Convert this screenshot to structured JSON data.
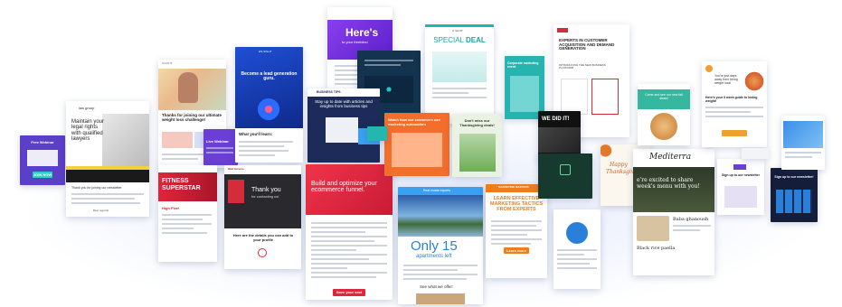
{
  "templates": {
    "t_webinar_small": {
      "headline": "Free Webinar",
      "button": "JOIN NOW"
    },
    "t_legal": {
      "brand": "law group",
      "headline": "Maintain your legal rights with qualified lawyers",
      "body": "Thank you for joining our newsletter",
      "signoff": "Best regards"
    },
    "t_weight": {
      "brand": "SLIMFIT",
      "headline": "Thanks for joining our ultimate weight loss challenge!"
    },
    "t_live": {
      "headline": "Live Webinar"
    },
    "t_fitness": {
      "headline1": "FITNESS",
      "headline2": "SUPERSTAR",
      "sub": "High Five!"
    },
    "t_leadgen": {
      "brand": "EN-SIGHT",
      "headline": "Become a lead generation guru.",
      "list_title": "What you'll learn:"
    },
    "t_contact": {
      "brand": "Well Service",
      "headline": "Thank you",
      "sub": "for contacting us!",
      "details": "Here are the details you can add to your profile"
    },
    "t_heres": {
      "headline": "Here's",
      "sub": "to your freebies!"
    },
    "t_business": {
      "brand": "BUSINESS TIPS",
      "headline": "Stay up to date with articles and insights from business tips"
    },
    "t_ecommerce": {
      "headline": "Build and optimize your ecommerce funnel.",
      "button": "Save your seat"
    },
    "t_special": {
      "brand": "O SHOP",
      "headline1": "SPECIAL",
      "headline2": "DEAL"
    },
    "t_calendar": {
      "headline": "Watch how our customers use marketing automation"
    },
    "t_thanksgiving_post": {
      "headline": "Don't miss our Thanksgiving deals!"
    },
    "t_apartments": {
      "brand": "Real estate experts",
      "big": "Only 15",
      "sub": "apartments left",
      "offer": "See what we offer:"
    },
    "t_marketing": {
      "brand": "MARKETING MASTERS",
      "headline": "LEARN EFFECTIVE MARKETING TACTICS FROM EXPERTS",
      "button": "Learn more"
    },
    "t_corporate": {
      "headline": "Corporate marketing event"
    },
    "t_experts": {
      "headline": "EXPERTS IN CUSTOMER ACQUISITION AND DEMAND GENERATION",
      "sub": "INTRODUCING THE NEW BUSINESS PLATFORM"
    },
    "t_wedid": {
      "headline": "WE DID IT!"
    },
    "t_happy": {
      "headline1": "Happy",
      "headline2": "Thanksgiving"
    },
    "t_recipe": {
      "brand": "Mediterra",
      "headline": "e're excited to share week's menu with you!",
      "dish1": "Baba ghanoush",
      "dish2": "Black rice paella"
    },
    "t_promo": {
      "headline": "Come and see our new fall deals!"
    },
    "t_food": {
      "headline": "You're just days away from being weight loss!",
      "sub": "Here's your 5 week guide to losing weight!"
    },
    "t_keyword": {
      "headline": "Sign up to our newsletter"
    },
    "t_dark": {
      "headline": "Sign up to our newsletter!"
    },
    "t_blue": {
      "headline": ""
    }
  },
  "colors": {
    "purple": "#6b3fd6",
    "blue": "#1f4fd6",
    "red": "#d62b3a",
    "teal": "#19b8b0",
    "green": "#27a36c",
    "orange": "#f07d1c",
    "dark": "#1a1a22",
    "navy": "#1d2b5a",
    "pink": "#ef5a7e"
  }
}
